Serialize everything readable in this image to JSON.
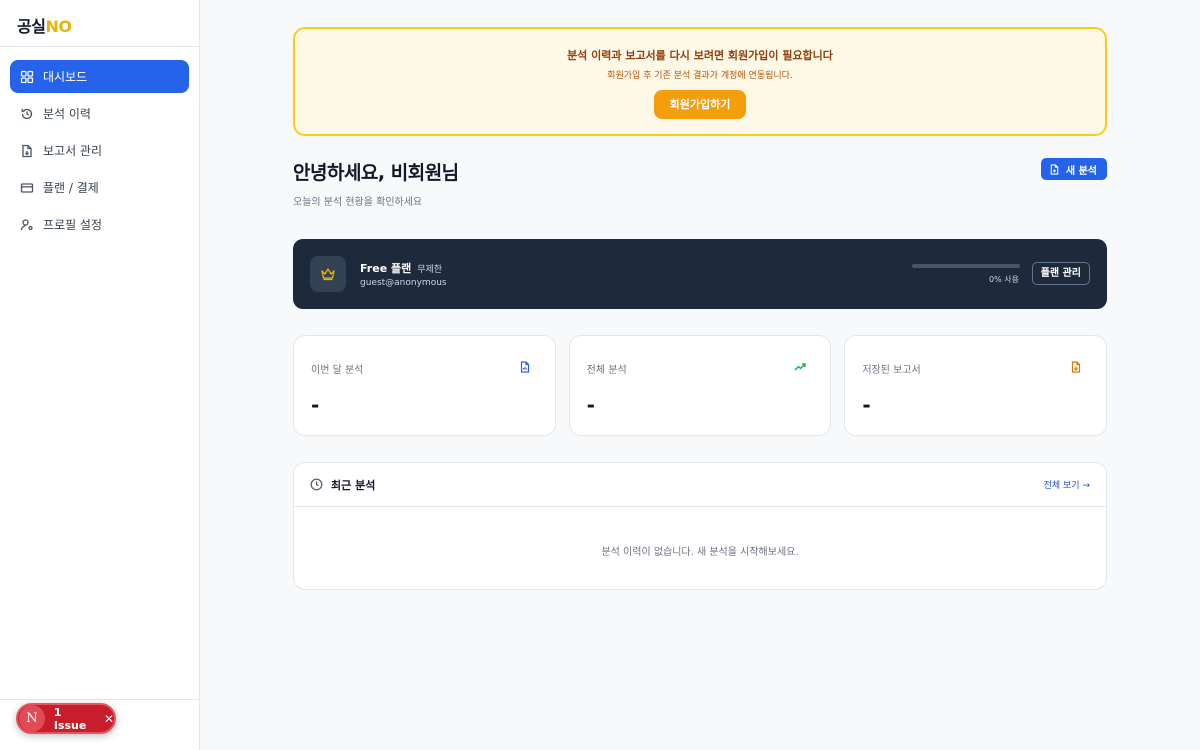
{
  "brand": {
    "part1": "공실",
    "part2": "NO"
  },
  "sidebar": {
    "items": [
      {
        "label": "대시보드",
        "icon": "grid-icon",
        "active": true
      },
      {
        "label": "분석 이력",
        "icon": "history-icon"
      },
      {
        "label": "보고서 관리",
        "icon": "file-icon"
      },
      {
        "label": "플랜 / 결제",
        "icon": "credit-card-icon"
      },
      {
        "label": "프로필 설정",
        "icon": "user-settings-icon"
      }
    ]
  },
  "banner": {
    "title": "분석 이력과 보고서를 다시 보려면 회원가입이 필요합니다",
    "subtitle": "회원가입 후 기존 분석 결과가 계정에 연동됩니다.",
    "button": "회원가입하기"
  },
  "greeting": {
    "title": "안녕하세요, 비회원님",
    "subtitle": "오늘의 분석 현황을 확인하세요",
    "new_button": "새 분석"
  },
  "plan": {
    "name": "Free 플랜",
    "tag": "무제한",
    "email": "guest@anonymous",
    "usage_percent": 0,
    "usage_text": "0% 사용",
    "manage_button": "플랜 관리"
  },
  "stats": [
    {
      "label": "이번 달 분석",
      "value": "-",
      "icon": "file-chart-icon",
      "color": "#2563eb"
    },
    {
      "label": "전체 분석",
      "value": "-",
      "icon": "trending-up-icon",
      "color": "#16a34a"
    },
    {
      "label": "저장된 보고서",
      "value": "-",
      "icon": "file-download-icon",
      "color": "#d97706"
    }
  ],
  "recent": {
    "title": "최근 분석",
    "link": "전체 보기 →",
    "empty": "분석 이력이 없습니다. 새 분석을 시작해보세요."
  },
  "issue": {
    "badge": "N",
    "label": "1 Issue",
    "close": "✕"
  },
  "colors": {
    "accent": "#2563eb",
    "banner_bg": "#fef9e7",
    "banner_border": "#facc15",
    "plan_bg": "#1e293b",
    "issue_red": "#c81e2b"
  }
}
